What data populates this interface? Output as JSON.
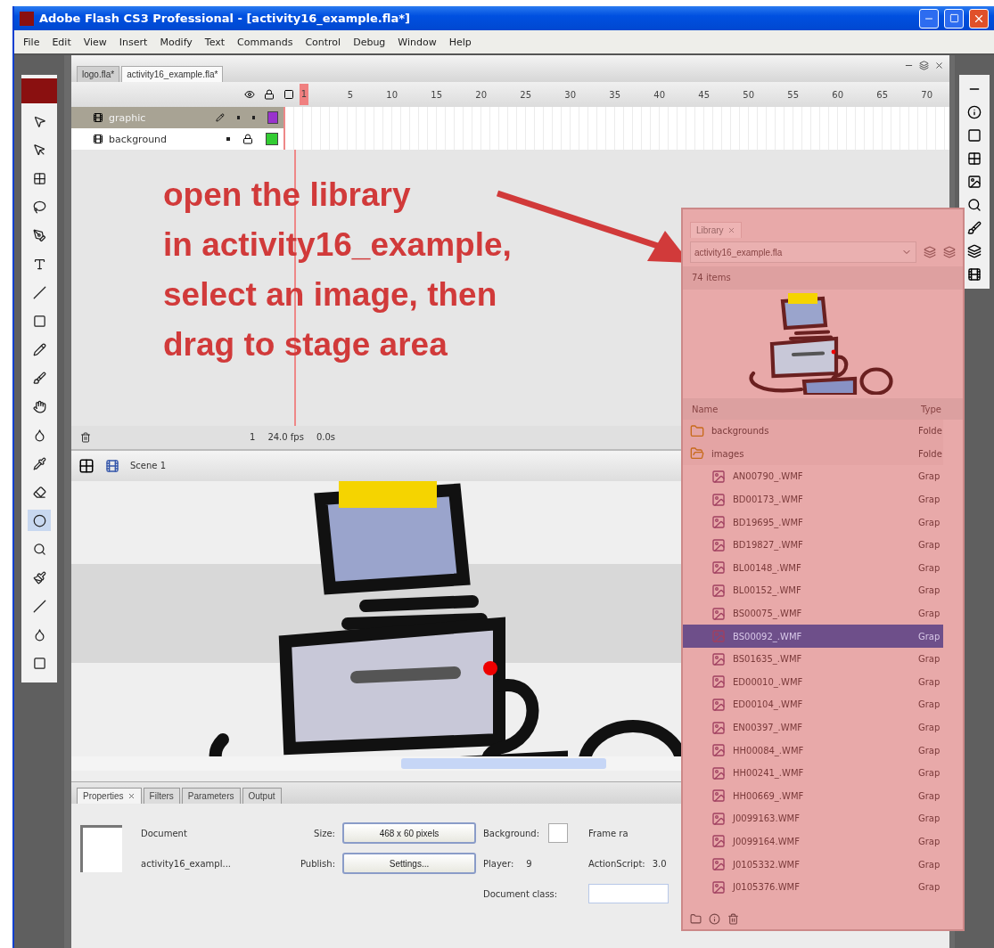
{
  "window": {
    "title": "Adobe Flash CS3 Professional - [activity16_example.fla*]"
  },
  "menu": [
    "File",
    "Edit",
    "View",
    "Insert",
    "Modify",
    "Text",
    "Commands",
    "Control",
    "Debug",
    "Window",
    "Help"
  ],
  "doc_tabs": [
    {
      "label": "logo.fla*",
      "selected": false
    },
    {
      "label": "activity16_example.fla*",
      "selected": true
    }
  ],
  "timeline": {
    "ruler": [
      "1",
      "5",
      "10",
      "15",
      "20",
      "25",
      "30",
      "35",
      "40",
      "45",
      "50",
      "55",
      "60",
      "65",
      "70"
    ],
    "layers": [
      {
        "name": "graphic",
        "selected": true,
        "locked": false,
        "color": "#9933cc"
      },
      {
        "name": "background",
        "selected": false,
        "locked": true,
        "color": "#33cc33"
      }
    ],
    "frame": "1",
    "fps": "24.0 fps",
    "time": "0.0s"
  },
  "edit_bar": {
    "scene": "Scene 1"
  },
  "annotation": {
    "lines": [
      "open the library",
      "in activity16_example,",
      "select an image, then",
      "drag to stage area"
    ]
  },
  "properties": {
    "tabs": [
      {
        "label": "Properties",
        "selected": true
      },
      {
        "label": "Filters",
        "selected": false
      },
      {
        "label": "Parameters",
        "selected": false
      },
      {
        "label": "Output",
        "selected": false
      }
    ],
    "doc_type": "Document",
    "doc_name": "activity16_exampl...",
    "size_label": "Size:",
    "size_value": "468 x 60 pixels",
    "publish_label": "Publish:",
    "publish_button": "Settings...",
    "background_label": "Background:",
    "frame_rate_label": "Frame ra",
    "player_label": "Player:",
    "player_value": "9",
    "as_label": "ActionScript:",
    "as_value": "3.0",
    "class_label": "Document class:"
  },
  "library": {
    "tab": "Library",
    "document": "activity16_example.fla",
    "count": "74 items",
    "columns": [
      "Name",
      "Type"
    ],
    "items": [
      {
        "kind": "folder",
        "name": "backgrounds",
        "type": "Folde",
        "selected": false,
        "expanded": false
      },
      {
        "kind": "folder",
        "name": "images",
        "type": "Folde",
        "selected": false,
        "expanded": true,
        "children": [
          {
            "kind": "graphic",
            "name": "AN00790_.WMF",
            "type": "Grap",
            "selected": false
          },
          {
            "kind": "graphic",
            "name": "BD00173_.WMF",
            "type": "Grap",
            "selected": false
          },
          {
            "kind": "graphic",
            "name": "BD19695_.WMF",
            "type": "Grap",
            "selected": false
          },
          {
            "kind": "graphic",
            "name": "BD19827_.WMF",
            "type": "Grap",
            "selected": false
          },
          {
            "kind": "graphic",
            "name": "BL00148_.WMF",
            "type": "Grap",
            "selected": false
          },
          {
            "kind": "graphic",
            "name": "BL00152_.WMF",
            "type": "Grap",
            "selected": false
          },
          {
            "kind": "graphic",
            "name": "BS00075_.WMF",
            "type": "Grap",
            "selected": false
          },
          {
            "kind": "graphic",
            "name": "BS00092_.WMF",
            "type": "Grap",
            "selected": true
          },
          {
            "kind": "graphic",
            "name": "BS01635_.WMF",
            "type": "Grap",
            "selected": false
          },
          {
            "kind": "graphic",
            "name": "ED00010_.WMF",
            "type": "Grap",
            "selected": false
          },
          {
            "kind": "graphic",
            "name": "ED00104_.WMF",
            "type": "Grap",
            "selected": false
          },
          {
            "kind": "graphic",
            "name": "EN00397_.WMF",
            "type": "Grap",
            "selected": false
          },
          {
            "kind": "graphic",
            "name": "HH00084_.WMF",
            "type": "Grap",
            "selected": false
          },
          {
            "kind": "graphic",
            "name": "HH00241_.WMF",
            "type": "Grap",
            "selected": false
          },
          {
            "kind": "graphic",
            "name": "HH00669_.WMF",
            "type": "Grap",
            "selected": false
          },
          {
            "kind": "graphic",
            "name": "J0099163.WMF",
            "type": "Grap",
            "selected": false
          },
          {
            "kind": "graphic",
            "name": "J0099164.WMF",
            "type": "Grap",
            "selected": false
          },
          {
            "kind": "graphic",
            "name": "J0105332.WMF",
            "type": "Grap",
            "selected": false
          },
          {
            "kind": "graphic",
            "name": "J0105376.WMF",
            "type": "Grap",
            "selected": false
          }
        ]
      }
    ]
  }
}
